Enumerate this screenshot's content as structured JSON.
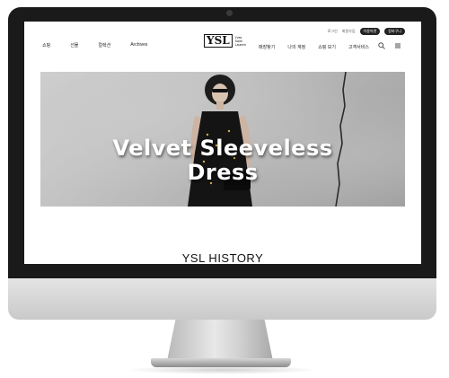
{
  "header": {
    "utility_links": [
      "로그인",
      "회원가입"
    ],
    "utility_pills": [
      "이용약관",
      "장바구니"
    ],
    "nav_left": [
      "쇼핑",
      "선물",
      "컬렉션",
      "Archives"
    ],
    "logo": {
      "mark": "YSL",
      "line1": "Yves",
      "line2": "Saint",
      "line3": "Laurent"
    },
    "nav_right": [
      "매장찾기",
      "나의 계정",
      "쇼핑 보기",
      "고객서비스"
    ]
  },
  "hero": {
    "title_line1": "Velvet Sleeveless",
    "title_line2": "Dress"
  },
  "section": {
    "heading": "YSL HISTORY"
  },
  "colors": {
    "bezel": "#1a1a1a",
    "chin": "#d6d6d6",
    "pill": "#222222"
  },
  "icons": [
    "search-icon",
    "menu-icon"
  ]
}
